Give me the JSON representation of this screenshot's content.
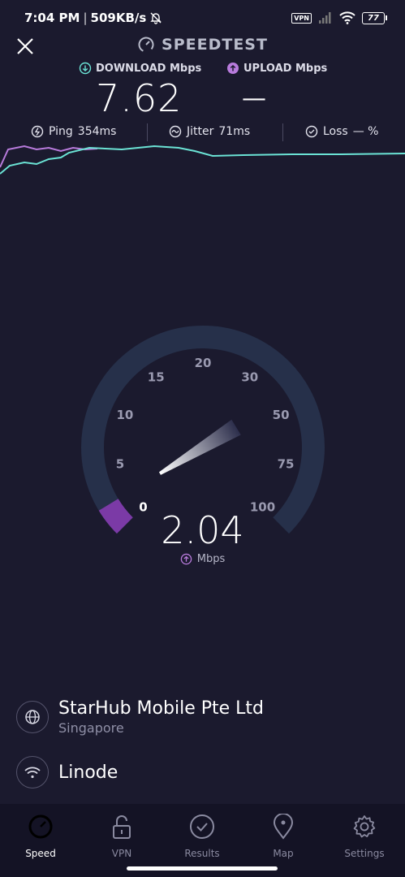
{
  "status_bar": {
    "time": "7:04 PM",
    "net_speed": "509KB/s",
    "vpn": "VPN",
    "battery": "77"
  },
  "header": {
    "title": "SPEEDTEST"
  },
  "metrics": {
    "download_label": "DOWNLOAD Mbps",
    "download_value": "7.62",
    "upload_label": "UPLOAD Mbps",
    "upload_value": "—"
  },
  "stats": {
    "ping_label": "Ping",
    "ping_value": "354ms",
    "jitter_label": "Jitter",
    "jitter_value": "71ms",
    "loss_label": "Loss",
    "loss_value": "— %"
  },
  "gauge": {
    "ticks": [
      "0",
      "5",
      "10",
      "15",
      "20",
      "30",
      "50",
      "75",
      "100"
    ],
    "needle_value": 2.04,
    "current_speed": "2.04",
    "unit": "Mbps"
  },
  "provider": {
    "name": "StarHub Mobile Pte Ltd",
    "location": "Singapore"
  },
  "server": {
    "name": "Linode"
  },
  "nav": [
    {
      "label": "Speed",
      "icon": "speed-gauge-icon",
      "active": true
    },
    {
      "label": "VPN",
      "icon": "unlock-icon",
      "active": false
    },
    {
      "label": "Results",
      "icon": "check-circle-icon",
      "active": false
    },
    {
      "label": "Map",
      "icon": "map-pin-icon",
      "active": false
    },
    {
      "label": "Settings",
      "icon": "gear-icon",
      "active": false
    }
  ],
  "colors": {
    "background": "#1b1a2e",
    "download_accent": "#6be3d5",
    "upload_accent": "#b87bdc",
    "gauge_track": "#26304a",
    "gauge_fill": "#7b3aa6"
  }
}
